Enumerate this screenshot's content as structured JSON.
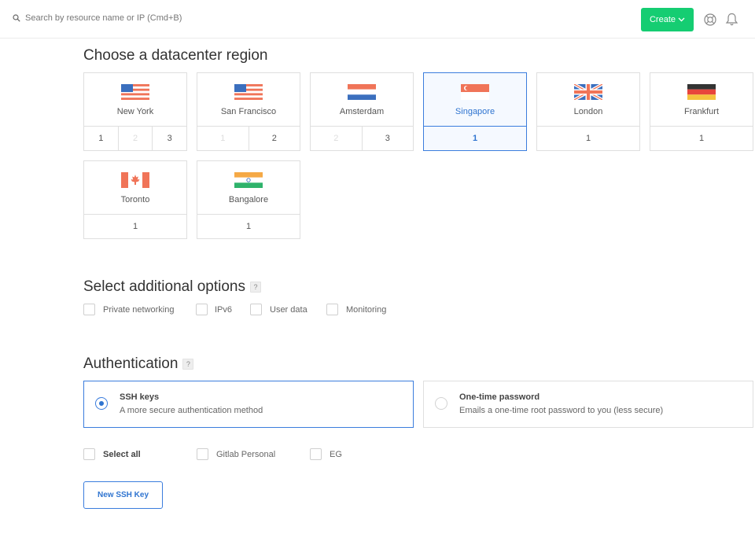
{
  "topbar": {
    "search_placeholder": "Search by resource name or IP (Cmd+B)",
    "create_label": "Create",
    "icons": [
      "search-icon",
      "chevron-down-icon",
      "help-lifebuoy-icon",
      "bell-icon"
    ]
  },
  "datacenter": {
    "heading": "Choose a datacenter region",
    "regions": [
      {
        "name": "New York",
        "flag": "us",
        "dcs": [
          {
            "n": "1",
            "enabled": true
          },
          {
            "n": "2",
            "enabled": false
          },
          {
            "n": "3",
            "enabled": true
          }
        ],
        "selected": false
      },
      {
        "name": "San Francisco",
        "flag": "us",
        "dcs": [
          {
            "n": "1",
            "enabled": false
          },
          {
            "n": "2",
            "enabled": true
          }
        ],
        "selected": false
      },
      {
        "name": "Amsterdam",
        "flag": "nl",
        "dcs": [
          {
            "n": "2",
            "enabled": false
          },
          {
            "n": "3",
            "enabled": true
          }
        ],
        "selected": false
      },
      {
        "name": "Singapore",
        "flag": "sg",
        "dcs": [
          {
            "n": "1",
            "enabled": true
          }
        ],
        "selected": true
      },
      {
        "name": "London",
        "flag": "gb",
        "dcs": [
          {
            "n": "1",
            "enabled": true
          }
        ],
        "selected": false
      },
      {
        "name": "Frankfurt",
        "flag": "de",
        "dcs": [
          {
            "n": "1",
            "enabled": true
          }
        ],
        "selected": false
      },
      {
        "name": "Toronto",
        "flag": "ca",
        "dcs": [
          {
            "n": "1",
            "enabled": true
          }
        ],
        "selected": false
      },
      {
        "name": "Bangalore",
        "flag": "in",
        "dcs": [
          {
            "n": "1",
            "enabled": true
          }
        ],
        "selected": false
      }
    ]
  },
  "options": {
    "heading": "Select additional options",
    "help": "?",
    "items": [
      {
        "label": "Private networking",
        "checked": false
      },
      {
        "label": "IPv6",
        "checked": false
      },
      {
        "label": "User data",
        "checked": false
      },
      {
        "label": "Monitoring",
        "checked": false
      }
    ]
  },
  "authentication": {
    "heading": "Authentication",
    "help": "?",
    "methods": [
      {
        "title": "SSH keys",
        "description": "A more secure authentication method",
        "selected": true
      },
      {
        "title": "One-time password",
        "description": "Emails a one-time root password to you (less secure)",
        "selected": false
      }
    ],
    "ssh_keys": [
      {
        "label": "Select all",
        "checked": false
      },
      {
        "label": "Gitlab Personal",
        "checked": false
      },
      {
        "label": "EG",
        "checked": false
      }
    ],
    "new_key_label": "New SSH Key"
  },
  "colors": {
    "accent": "#2f74d0",
    "create_button": "#15cd72",
    "border": "#dfdfdf"
  }
}
